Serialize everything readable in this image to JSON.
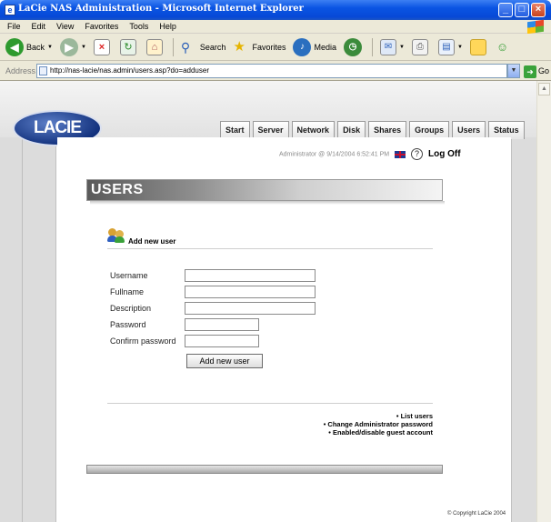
{
  "window": {
    "title": "LaCie NAS Administration - Microsoft Internet Explorer",
    "min": "_",
    "max": "□",
    "close": "×"
  },
  "menu": [
    "File",
    "Edit",
    "View",
    "Favorites",
    "Tools",
    "Help"
  ],
  "toolbar": {
    "back": "Back",
    "search": "Search",
    "favorites": "Favorites",
    "media": "Media"
  },
  "address": {
    "label": "Address",
    "url": "http://nas-lacie/nas.admin/users.asp?do=adduser",
    "go": "Go"
  },
  "site": {
    "logo": "LACIE",
    "tabs": [
      "Start",
      "Server",
      "Network",
      "Disk",
      "Shares",
      "Groups",
      "Users",
      "Status"
    ],
    "status_text": "Administrator @ 9/14/2004 6:52:41 PM",
    "help": "?",
    "logoff": "Log Off"
  },
  "users": {
    "header": "USERS",
    "section_title": "Add new user",
    "fields": [
      "Username",
      "Fullname",
      "Description",
      "Password",
      "Confirm password"
    ],
    "values": [
      "",
      "",
      "",
      "",
      ""
    ],
    "submit": "Add new user",
    "links": [
      "• List users",
      "• Change Administrator password",
      "• Enabled/disable guest account"
    ]
  },
  "footer": {
    "copyright": "© Copyright LaCie 2004"
  },
  "colors": {
    "titlebar": "#0a54e3",
    "logo": "#0f2e7a",
    "chrome": "#ece9d8"
  }
}
